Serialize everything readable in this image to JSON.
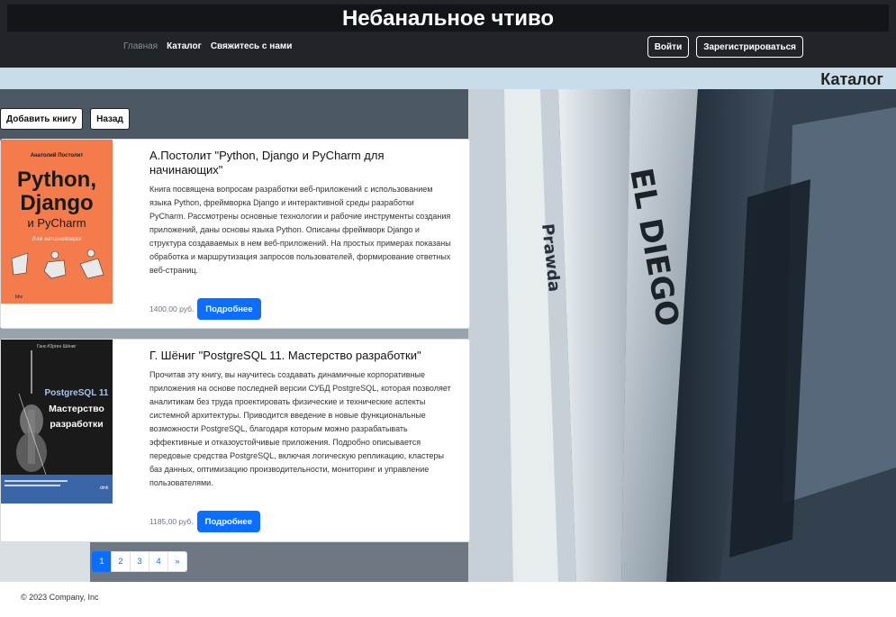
{
  "header": {
    "site_title": "Небанальное чтиво",
    "nav": [
      {
        "label": "Главная",
        "active": false
      },
      {
        "label": "Каталог",
        "active": true
      },
      {
        "label": "Свяжитесь с нами",
        "active": true
      }
    ],
    "login_label": "Войти",
    "register_label": "Зарегистрироваться"
  },
  "catalog": {
    "heading": "Каталог",
    "add_book_label": "Добавить книгу",
    "back_label": "Назад"
  },
  "books": [
    {
      "title": "А.Постолит \"Python, Django и PyCharm для начинающих\"",
      "description": "Книга посвящена вопросам разработки веб-приложений с использованием языка Python, фреймворка Django и интерактивной среды разработки PyCharm. Рассмотрены основные технологии и рабочие инструменты создания приложений, даны основы языка Python. Описаны фреймворк Django и структура создаваемых в нем веб-приложений. На простых примерах показаны обработка и маршрутизация запросов пользователей, формирование ответных веб-страниц.",
      "price": "1400,00 руб.",
      "details_label": "Подробнее",
      "cover": {
        "author": "Анатолий Постолит",
        "line1": "Python,",
        "line2": "Django",
        "line3": "и PyCharm",
        "line4": "для начинающих",
        "bg_color": "#f47c4c"
      }
    },
    {
      "title": "Г. Шёниг \"PostgreSQL 11. Мастерство разработки\"",
      "description": "Прочитав эту книгу, вы научитесь создавать динамичные корпоративные приложения на основе последней версии СУБД PostgreSQL, которая позволяет аналитикам без труда проектировать физические и технические аспекты системной архитектуры. Приводится введение в новые функциональные возможности PostgreSQL, благодаря которым можно разрабатывать эффективные и отказоустойчивые приложения. Подробно описывается передовые средства PostgreSQL, включая логическую репликацию, кластеры баз данных, оптимизацию производительности, мониторинг и управление пользователями.",
      "price": "1185,00 руб.",
      "details_label": "Подробнее",
      "cover": {
        "author": "Ганс-Юрген Шёниг",
        "line1": "PostgreSQL 11",
        "line2": "Мастерство",
        "line3": "разработки",
        "bg_color": "#1a1a1a"
      }
    }
  ],
  "pagination": {
    "pages": [
      "1",
      "2",
      "3",
      "4",
      "»"
    ],
    "active": "1"
  },
  "footer": {
    "copyright": "© 2023 Company, Inc"
  }
}
